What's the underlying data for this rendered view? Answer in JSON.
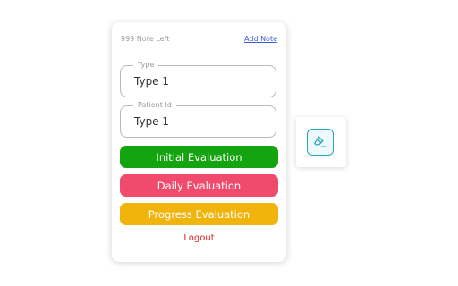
{
  "popup": {
    "notes_left": "999 Note Left",
    "add_note": "Add Note",
    "fields": {
      "type": {
        "legend": "Type",
        "value": "Type 1"
      },
      "patient_id": {
        "legend": "Patient Id",
        "value": "Type 1"
      }
    },
    "buttons": {
      "initial": "Initial Evaluation",
      "daily": "Daily Evaluation",
      "progress": "Progress Evaluation"
    },
    "logout": "Logout"
  },
  "side_button": {
    "icon": "eraser-icon"
  },
  "colors": {
    "initial": "#14a40f",
    "daily": "#f04a6c",
    "progress": "#f1b40c",
    "logout": "#e02020",
    "link": "#3b5bdb",
    "side_accent": "#2aa6b8"
  }
}
